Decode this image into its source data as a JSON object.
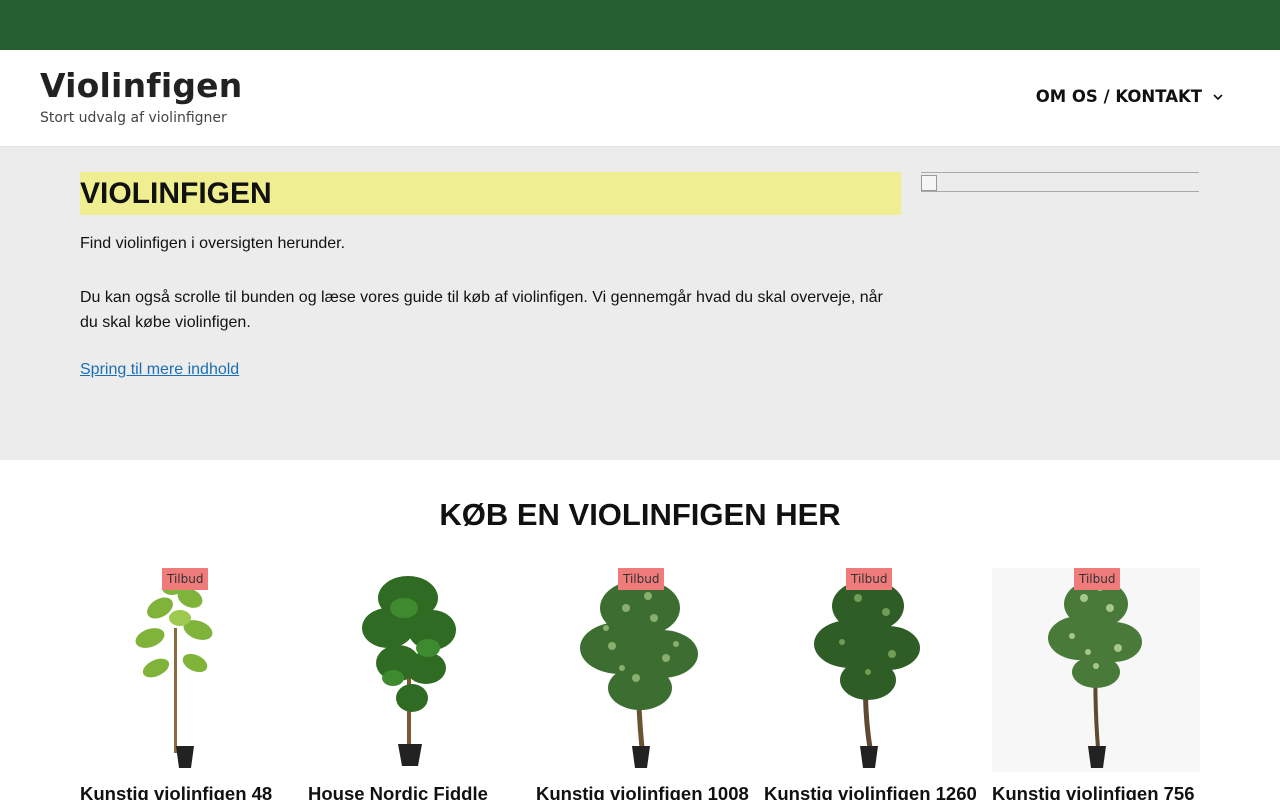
{
  "header": {
    "site_title": "Violinfigen",
    "tagline": "Stort udvalg af violinfigner",
    "nav_label": "OM OS / KONTAKT"
  },
  "hero": {
    "title": "VIOLINFIGEN",
    "paragraph1": "Find violinfigen i oversigten herunder.",
    "paragraph2": "Du kan også scrolle til bunden og læse vores guide til køb af violinfigen. Vi gennemgår hvad du skal overveje, når du skal købe violinfigen.",
    "link": "Spring til mere indhold"
  },
  "products": {
    "heading": "KØB EN VIOLINFIGEN HER",
    "items": [
      {
        "title": "Kunstig violinfigen 48",
        "badge": "Tilbud"
      },
      {
        "title": "House Nordic Fiddle",
        "badge": ""
      },
      {
        "title": "Kunstig violinfigen 1008",
        "badge": "Tilbud"
      },
      {
        "title": "Kunstig violinfigen 1260",
        "badge": "Tilbud"
      },
      {
        "title": "Kunstig violinfigen 756",
        "badge": "Tilbud"
      }
    ]
  },
  "colors": {
    "topbar": "#265f32",
    "hero_bg": "#ececec",
    "title_highlight": "#efef91",
    "badge": "#f07b7b",
    "link": "#1a6fb5"
  },
  "icons": [
    "chevron-down-icon",
    "broken-image-icon"
  ]
}
